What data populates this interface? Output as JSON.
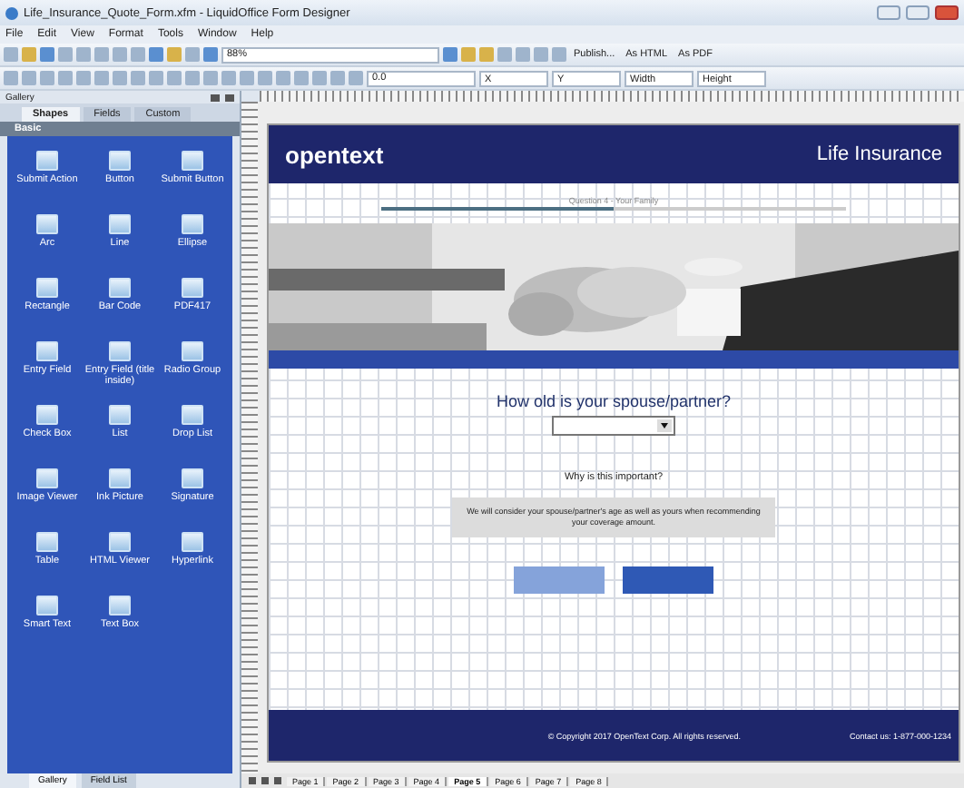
{
  "window": {
    "title": "Life_Insurance_Quote_Form.xfm - LiquidOffice Form Designer"
  },
  "menu": [
    "File",
    "Edit",
    "View",
    "Format",
    "Tools",
    "Window",
    "Help"
  ],
  "toolbar": {
    "zoom": "88%",
    "publish": [
      "Publish...",
      "As HTML",
      "As PDF"
    ]
  },
  "properties_bar": {
    "size": "0.0",
    "fields": [
      "X",
      "Y",
      "Width",
      "Height"
    ]
  },
  "gallery": {
    "title": "Gallery",
    "tabs": [
      {
        "label": "Shapes",
        "selected": true
      },
      {
        "label": "Fields",
        "selected": false
      },
      {
        "label": "Custom",
        "selected": false
      }
    ],
    "section": "Basic",
    "items": [
      {
        "label": "Submit Action"
      },
      {
        "label": "Button"
      },
      {
        "label": "Submit Button"
      },
      {
        "label": "Arc"
      },
      {
        "label": "Line"
      },
      {
        "label": "Ellipse"
      },
      {
        "label": "Rectangle"
      },
      {
        "label": "Bar Code"
      },
      {
        "label": "PDF417"
      },
      {
        "label": "Entry Field"
      },
      {
        "label": "Entry Field (title inside)"
      },
      {
        "label": "Radio Group"
      },
      {
        "label": "Check Box"
      },
      {
        "label": "List"
      },
      {
        "label": "Drop List"
      },
      {
        "label": "Image Viewer"
      },
      {
        "label": "Ink Picture"
      },
      {
        "label": "Signature"
      },
      {
        "label": "Table"
      },
      {
        "label": "HTML Viewer"
      },
      {
        "label": "Hyperlink"
      },
      {
        "label": "Smart Text"
      },
      {
        "label": "Text Box"
      }
    ],
    "bottom_tabs": [
      {
        "label": "Gallery",
        "selected": true
      },
      {
        "label": "Field List",
        "selected": false
      }
    ]
  },
  "form": {
    "logo": "opentext",
    "title": "Life Insurance",
    "progress": {
      "label": "Question 4 - Your Family",
      "level": 0.5
    },
    "question": "How old is your spouse/partner?",
    "why": "Why is this important?",
    "info": "We will consider your spouse/partner's age as well as yours when recommending your coverage amount.",
    "copyright": "© Copyright 2017 OpenText Corp. All rights reserved.",
    "contact": "Contact us: 1-877-000-1234"
  },
  "page_tabs": [
    {
      "label": "Page 1",
      "selected": false
    },
    {
      "label": "Page 2",
      "selected": false
    },
    {
      "label": "Page 3",
      "selected": false
    },
    {
      "label": "Page 4",
      "selected": false
    },
    {
      "label": "Page 5",
      "selected": true
    },
    {
      "label": "Page 6",
      "selected": false
    },
    {
      "label": "Page 7",
      "selected": false
    },
    {
      "label": "Page 8",
      "selected": false
    }
  ]
}
